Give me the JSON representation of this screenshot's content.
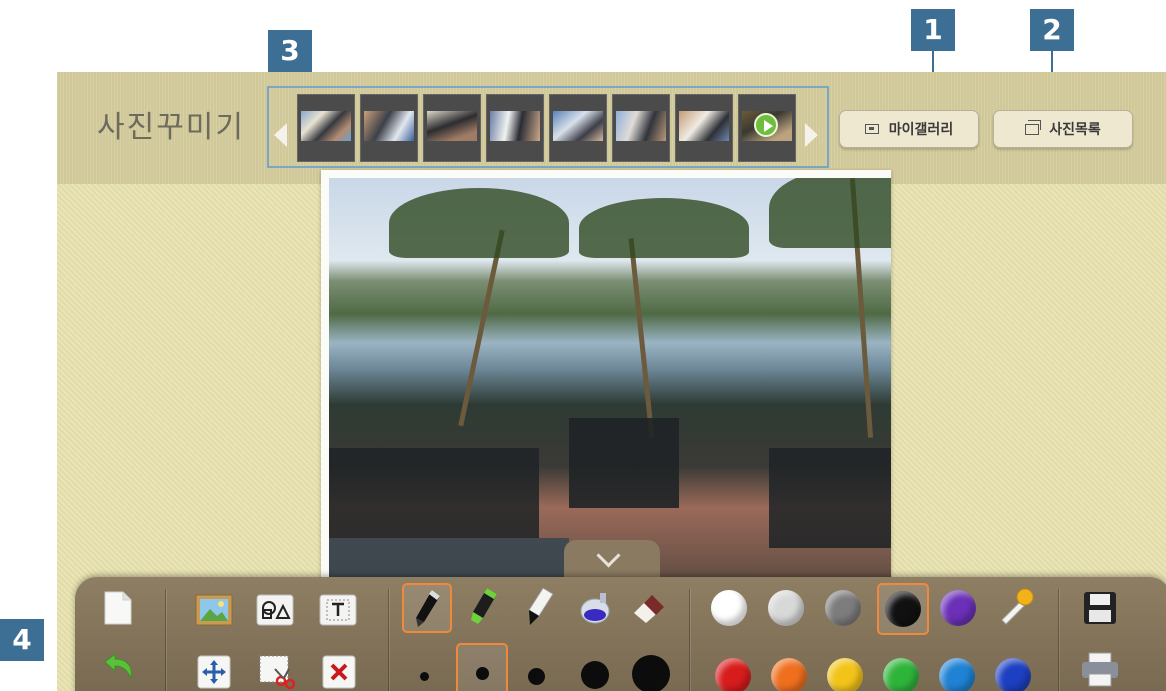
{
  "header": {
    "title": "사진꾸미기",
    "my_gallery_label": "마이갤러리",
    "photo_list_label": "사진목록"
  },
  "strip": {
    "thumbnail_count": 8,
    "video_thumbnail_index": 8
  },
  "callouts": [
    "1",
    "2",
    "3",
    "4"
  ],
  "toolbar": {
    "file_tools": [
      "new-page-icon",
      "undo-icon"
    ],
    "edit_tools": [
      "background-image-icon",
      "shapes-icon",
      "text-icon",
      "move-icon",
      "cut-icon",
      "delete-icon"
    ],
    "pens": [
      "marker-icon",
      "highlighter-icon",
      "brush-pen-icon",
      "paint-bucket-icon",
      "eraser-icon"
    ],
    "selected_pen": "marker-icon",
    "brush_sizes": 5,
    "selected_brush_size": 2,
    "colors": [
      "#ffffff",
      "#d8d8d8",
      "#7c7c7c",
      "#111111",
      "#6b2fb8",
      "#d81c1c",
      "#ef6f1e",
      "#f2c419",
      "#2fb43a",
      "#1f82d4",
      "#1d3fc2"
    ],
    "selected_color": "#111111",
    "dropper": "eyedropper-icon",
    "actions": [
      "save-icon",
      "print-icon"
    ]
  },
  "colors": {
    "accent": "#3d6e94",
    "selection": "#f08a3a"
  }
}
